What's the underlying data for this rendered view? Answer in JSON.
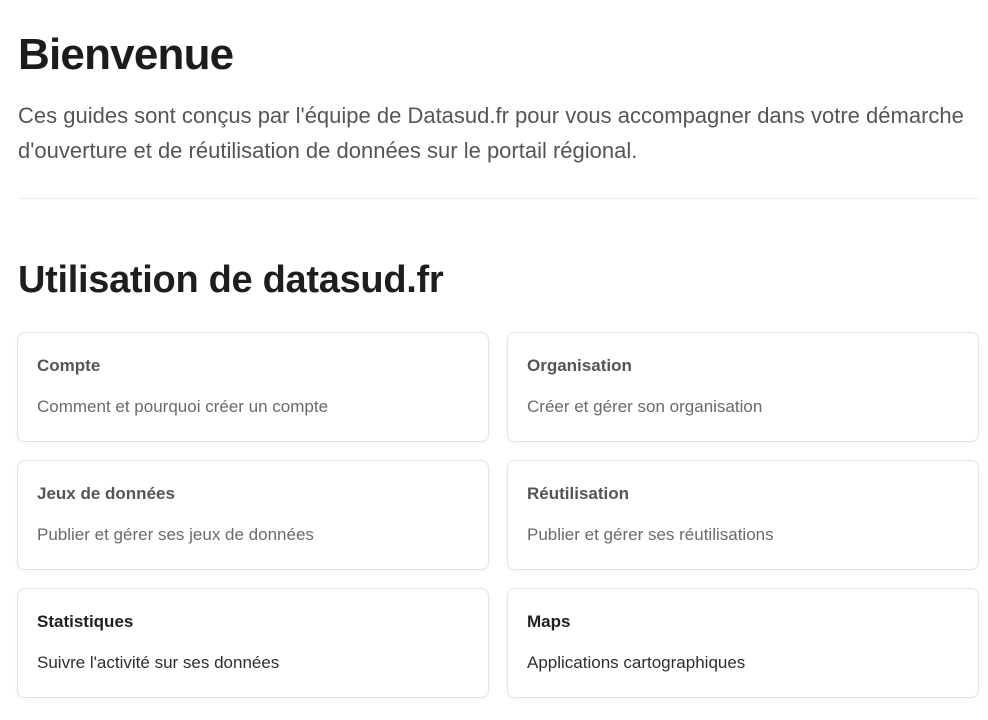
{
  "header": {
    "title": "Bienvenue",
    "intro": "Ces guides sont conçus par l'équipe de Datasud.fr pour vous accompagner dans votre démarche d'ouverture et de réutilisation de données sur le portail régional."
  },
  "section": {
    "title": "Utilisation de datasud.fr"
  },
  "cards": [
    {
      "title": "Compte",
      "description": "Comment et pourquoi créer un compte"
    },
    {
      "title": "Organisation",
      "description": "Créer et gérer son organisation"
    },
    {
      "title": "Jeux de données",
      "description": "Publier et gérer ses jeux de données"
    },
    {
      "title": "Réutilisation",
      "description": "Publier et gérer ses réutilisations"
    },
    {
      "title": "Statistiques",
      "description": "Suivre l'activité sur ses données"
    },
    {
      "title": "Maps",
      "description": "Applications cartographiques"
    }
  ]
}
